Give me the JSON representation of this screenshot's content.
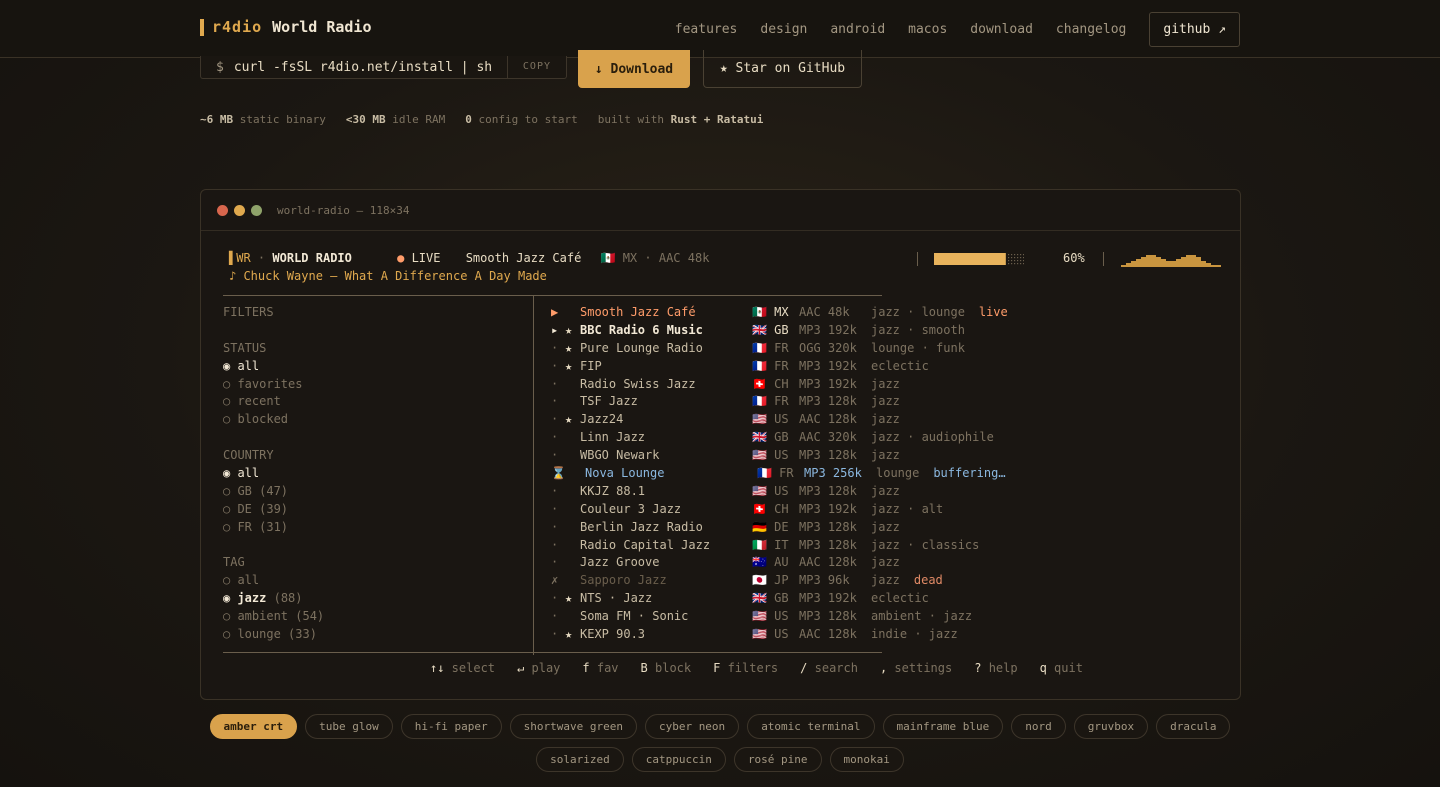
{
  "brand": {
    "logo": "r4dio",
    "name": "World Radio"
  },
  "nav": {
    "items": [
      "features",
      "design",
      "android",
      "macos",
      "download",
      "changelog"
    ],
    "github": "github ↗"
  },
  "hero": {
    "prompt": "$",
    "command": "curl -fsSL r4dio.net/install | sh",
    "copy": "COPY",
    "download": "↓ Download",
    "star": "★ Star on GitHub"
  },
  "stats": [
    {
      "value": "~6 MB",
      "label": "static binary"
    },
    {
      "value": "<30 MB",
      "label": "idle RAM"
    },
    {
      "value": "0",
      "label": "config to start"
    },
    {
      "value": "",
      "label": "built with",
      "extra": "Rust + Ratatui"
    }
  ],
  "terminal": {
    "title": "world-radio — 118×34",
    "dot_colors": [
      "#d8664d",
      "#e0a94e",
      "#8fa36a"
    ],
    "header": {
      "badge": "▌WR",
      "sep": "·",
      "name": "WORLD RADIO",
      "live": "● LIVE",
      "station": "Smooth Jazz Café",
      "country": "🇲🇽 MX",
      "codec": "· AAC 48k",
      "volume": "60%",
      "volume_level": 0.6,
      "now_playing": "♪ Chuck Wayne — What A Difference A Day Made"
    },
    "filters": {
      "title": "FILTERS",
      "status_label": "STATUS",
      "status": [
        {
          "text": "◉ all",
          "active": true
        },
        {
          "text": "○ favorites",
          "active": false
        },
        {
          "text": "○ recent",
          "active": false
        },
        {
          "text": "○ blocked",
          "active": false
        }
      ],
      "country_label": "COUNTRY",
      "country": [
        {
          "text": "◉ all",
          "active": true
        },
        {
          "text": "○ GB (47)",
          "active": false
        },
        {
          "text": "○ DE (39)",
          "active": false
        },
        {
          "text": "○ FR (31)",
          "active": false
        }
      ],
      "tag_label": "TAG",
      "tag": [
        {
          "text": "○ all",
          "active": false
        },
        {
          "text": "◉ jazz",
          "count": "(88)",
          "active": true
        },
        {
          "text": "○ ambient (54)",
          "active": false
        },
        {
          "text": "○ lounge (33)",
          "active": false
        }
      ]
    },
    "stations": [
      {
        "mark": "▶",
        "star": "",
        "name": "Smooth Jazz Café",
        "country": "🇲🇽 MX",
        "codec": "AAC 48k",
        "tags": "jazz · lounge",
        "status": "live",
        "state": "playing"
      },
      {
        "mark": "▸",
        "star": "★",
        "name": "BBC Radio 6 Music",
        "country": "🇬🇧 GB",
        "codec": "MP3 192k",
        "tags": "jazz · smooth",
        "status": "",
        "state": "selected"
      },
      {
        "mark": "·",
        "star": "★",
        "name": "Pure Lounge Radio",
        "country": "🇫🇷 FR",
        "codec": "OGG 320k",
        "tags": "lounge · funk",
        "status": "",
        "state": ""
      },
      {
        "mark": "·",
        "star": "★",
        "name": "FIP",
        "country": "🇫🇷 FR",
        "codec": "MP3 192k",
        "tags": "eclectic",
        "status": "",
        "state": ""
      },
      {
        "mark": "·",
        "star": "",
        "name": "Radio Swiss Jazz",
        "country": "🇨🇭 CH",
        "codec": "MP3 192k",
        "tags": "jazz",
        "status": "",
        "state": ""
      },
      {
        "mark": "·",
        "star": "",
        "name": "TSF Jazz",
        "country": "🇫🇷 FR",
        "codec": "MP3 128k",
        "tags": "jazz",
        "status": "",
        "state": ""
      },
      {
        "mark": "·",
        "star": "★",
        "name": "Jazz24",
        "country": "🇺🇸 US",
        "codec": "AAC 128k",
        "tags": "jazz",
        "status": "",
        "state": ""
      },
      {
        "mark": "·",
        "star": "",
        "name": "Linn Jazz",
        "country": "🇬🇧 GB",
        "codec": "AAC 320k",
        "tags": "jazz · audiophile",
        "status": "",
        "state": ""
      },
      {
        "mark": "·",
        "star": "",
        "name": "WBGO Newark",
        "country": "🇺🇸 US",
        "codec": "MP3 128k",
        "tags": "jazz",
        "status": "",
        "state": ""
      },
      {
        "mark": "⌛",
        "star": "",
        "name": "Nova Lounge",
        "country": "🇫🇷 FR",
        "codec": "MP3 256k",
        "tags": "lounge",
        "status": "buffering…",
        "state": "buffering"
      },
      {
        "mark": "·",
        "star": "",
        "name": "KKJZ 88.1",
        "country": "🇺🇸 US",
        "codec": "MP3 128k",
        "tags": "jazz",
        "status": "",
        "state": ""
      },
      {
        "mark": "·",
        "star": "",
        "name": "Couleur 3 Jazz",
        "country": "🇨🇭 CH",
        "codec": "MP3 192k",
        "tags": "jazz · alt",
        "status": "",
        "state": ""
      },
      {
        "mark": "·",
        "star": "",
        "name": "Berlin Jazz Radio",
        "country": "🇩🇪 DE",
        "codec": "MP3 128k",
        "tags": "jazz",
        "status": "",
        "state": ""
      },
      {
        "mark": "·",
        "star": "",
        "name": "Radio Capital Jazz",
        "country": "🇮🇹 IT",
        "codec": "MP3 128k",
        "tags": "jazz · classics",
        "status": "",
        "state": ""
      },
      {
        "mark": "·",
        "star": "",
        "name": "Jazz Groove",
        "country": "🇦🇺 AU",
        "codec": "AAC 128k",
        "tags": "jazz",
        "status": "",
        "state": ""
      },
      {
        "mark": "✗",
        "star": "",
        "name": "Sapporo Jazz",
        "country": "🇯🇵 JP",
        "codec": "MP3 96k",
        "tags": "jazz",
        "status": "dead",
        "state": "dead"
      },
      {
        "mark": "·",
        "star": "★",
        "name": "NTS · Jazz",
        "country": "🇬🇧 GB",
        "codec": "MP3 192k",
        "tags": "eclectic",
        "status": "",
        "state": ""
      },
      {
        "mark": "·",
        "star": "",
        "name": "Soma FM · Sonic",
        "country": "🇺🇸 US",
        "codec": "MP3 128k",
        "tags": "ambient · jazz",
        "status": "",
        "state": ""
      },
      {
        "mark": "·",
        "star": "★",
        "name": "KEXP 90.3",
        "country": "🇺🇸 US",
        "codec": "AAC 128k",
        "tags": "indie · jazz",
        "status": "",
        "state": ""
      }
    ],
    "keys": [
      {
        "key": "↑↓",
        "label": "select"
      },
      {
        "key": "↵",
        "label": "play"
      },
      {
        "key": "f",
        "label": "fav"
      },
      {
        "key": "B",
        "label": "block"
      },
      {
        "key": "F",
        "label": "filters"
      },
      {
        "key": "/",
        "label": "search"
      },
      {
        "key": ",",
        "label": "settings"
      },
      {
        "key": "?",
        "label": "help"
      },
      {
        "key": "q",
        "label": "quit"
      }
    ]
  },
  "themes": {
    "row1": [
      "amber crt",
      "tube glow",
      "hi-fi paper",
      "shortwave green",
      "cyber neon",
      "atomic terminal",
      "mainframe blue",
      "nord",
      "gruvbox",
      "dracula"
    ],
    "row2": [
      "solarized",
      "catppuccin",
      "rosé pine",
      "monokai"
    ],
    "active": "amber crt"
  },
  "colors": {
    "accent": "#d9a24c",
    "live": "#ff9c6a",
    "buffering": "#8bb8e0"
  }
}
